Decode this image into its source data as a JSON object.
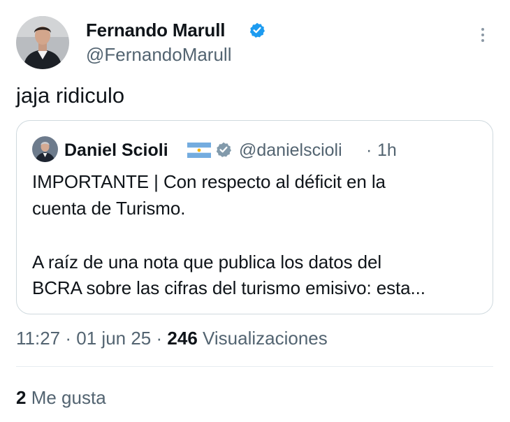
{
  "author": {
    "name": "Fernando Marull",
    "handle": "@FernandoMarull",
    "verified_color": "#1d9bf0"
  },
  "tweet": {
    "text": "jaja ridiculo"
  },
  "quoted": {
    "name": "Daniel Scioli",
    "flag_icon": "argentina-flag-icon",
    "verified_color": "#829aab",
    "handle": "@danielscioli",
    "separator": "·",
    "time": "1h",
    "lines": [
      "IMPORTANTE | Con respecto al déficit en la",
      "cuenta de Turismo.",
      "A raíz de una nota que publica los datos del",
      "BCRA sobre las cifras del turismo emisivo: esta..."
    ]
  },
  "meta": {
    "time": "11:27",
    "sep1": "·",
    "date": "01 jun 25",
    "sep2": "·",
    "views_count": "246",
    "views_label": "Visualizaciones"
  },
  "likes": {
    "count": "2",
    "label": "Me gusta"
  }
}
